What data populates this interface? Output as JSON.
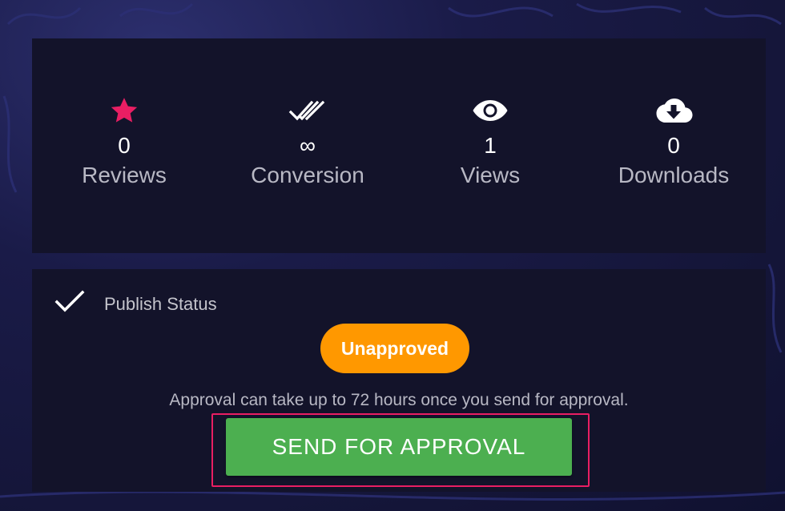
{
  "stats": [
    {
      "icon": "star-icon",
      "value": "0",
      "label": "Reviews"
    },
    {
      "icon": "double-check-icon",
      "value": "∞",
      "label": "Conversion"
    },
    {
      "icon": "eye-icon",
      "value": "1",
      "label": "Views"
    },
    {
      "icon": "cloud-download-icon",
      "value": "0",
      "label": "Downloads"
    }
  ],
  "publish": {
    "title": "Publish Status",
    "status": "Unapproved",
    "note": "Approval can take up to 72 hours once you send for approval.",
    "button_label": "SEND FOR APPROVAL"
  },
  "colors": {
    "star": "#e91e63",
    "badge": "#ff9800",
    "button": "#4caf50",
    "highlight": "#e91e63",
    "panel": "#13132a"
  }
}
